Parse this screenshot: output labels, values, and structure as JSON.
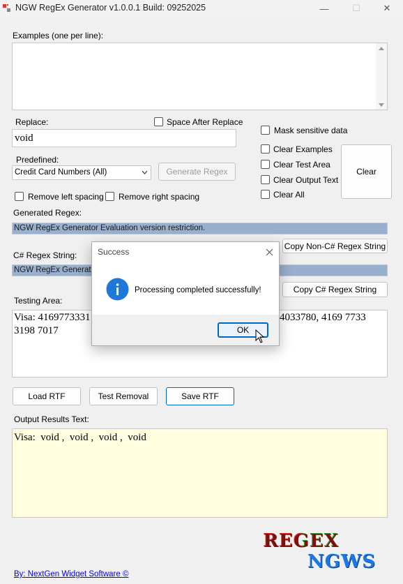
{
  "window": {
    "title": "NGW RegEx Generator v1.0.0.1 Build: 09252025",
    "minimize": "—",
    "maximize": "☐",
    "close": "✕"
  },
  "examples": {
    "label": "Examples (one per line):",
    "value": ""
  },
  "replace": {
    "label": "Replace:",
    "value": "void",
    "space_after_label": "Space After Replace",
    "space_after_checked": false
  },
  "predefined": {
    "label": "Predefined:",
    "selected": "Credit Card Numbers (All)",
    "generate_label": "Generate Regex"
  },
  "options": {
    "mask_sensitive": "Mask sensitive data",
    "clear_examples": "Clear Examples",
    "clear_test_area": "Clear Test Area",
    "clear_output_text": "Clear Output Text",
    "clear_all": "Clear All",
    "clear_button": "Clear"
  },
  "spacing": {
    "remove_left": "Remove left spacing",
    "remove_right": "Remove right spacing"
  },
  "generated_regex": {
    "label": "Generated Regex:",
    "value": "NGW RegEx Generator Evaluation version restriction.",
    "copy_label": "Copy Non-C# Regex String"
  },
  "csharp_regex": {
    "label": "C# Regex String:",
    "value": "NGW RegEx Generator Evaluation version restriction.",
    "copy_label": "Copy C# Regex String"
  },
  "testing_area": {
    "label": "Testing Area:",
    "line1_left": "Visa: 4169773331",
    "line1_right": "4033780, 4169 7733",
    "line2": "3198 7017"
  },
  "buttons": {
    "load_rtf": "Load RTF",
    "test_removal": "Test Removal",
    "save_rtf": "Save RTF"
  },
  "output": {
    "label": "Output Results Text:",
    "value": "Visa:  void ,  void ,  void ,  void"
  },
  "footer": {
    "credit": "By: NextGen Widget Software  ©",
    "logo_line1": "REGEX",
    "logo_line2": "NGWS"
  },
  "dialog": {
    "title": "Success",
    "message": "Processing completed successfully!",
    "ok_label": "OK",
    "icon": "info-icon"
  },
  "colors": {
    "accent": "#0067c0",
    "highlight": "#98b0cc",
    "output_bg": "#ffffe0",
    "logo_red": "#e02020",
    "logo_green": "#2aa02a",
    "logo_blue": "#1b79e6"
  }
}
